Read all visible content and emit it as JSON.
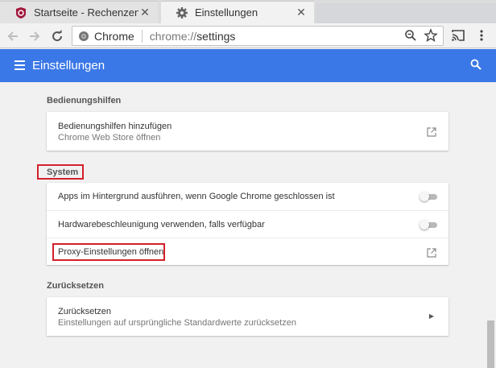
{
  "tabs": [
    {
      "title": "Startseite - Rechenzentru",
      "icon": "shield-logo-icon",
      "active": false
    },
    {
      "title": "Einstellungen",
      "icon": "gear-icon",
      "active": true
    }
  ],
  "toolbar": {
    "omnibox_chip": "Chrome",
    "url_scheme": "chrome://",
    "url_path": "settings"
  },
  "header": {
    "title": "Einstellungen"
  },
  "sections": {
    "accessibility": {
      "title": "Bedienungshilfen",
      "row1": {
        "primary": "Bedienungshilfen hinzufügen",
        "secondary": "Chrome Web Store öffnen"
      }
    },
    "system": {
      "title": "System",
      "rows": [
        {
          "primary": "Apps im Hintergrund ausführen, wenn Google Chrome geschlossen ist",
          "toggle": "off"
        },
        {
          "primary": "Hardwarebeschleunigung verwenden, falls verfügbar",
          "toggle": "off"
        },
        {
          "primary": "Proxy-Einstellungen öffnen"
        }
      ]
    },
    "reset": {
      "title": "Zurücksetzen",
      "row1": {
        "primary": "Zurücksetzen",
        "secondary": "Einstellungen auf ursprüngliche Standardwerte zurücksetzen"
      }
    }
  },
  "colors": {
    "header": "#3b78e7",
    "highlight": "#d3202c"
  }
}
